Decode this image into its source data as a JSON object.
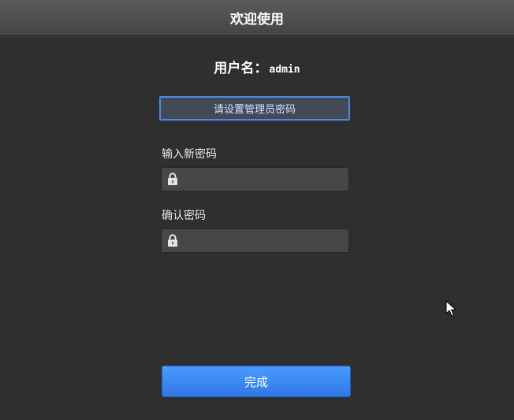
{
  "window": {
    "title": "欢迎使用"
  },
  "account": {
    "username_label": "用户名：",
    "username_value": "admin"
  },
  "notice": {
    "text": "请设置管理员密码"
  },
  "new_password": {
    "label": "输入新密码",
    "value": "",
    "icon": "lock-icon"
  },
  "confirm_password": {
    "label": "确认密码",
    "value": "",
    "icon": "lock-icon"
  },
  "actions": {
    "done_label": "完成"
  },
  "colors": {
    "background": "#2f2f2f",
    "titlebar": "#4f4f4f",
    "accent": "#3a86f0",
    "field_bg": "#474747"
  }
}
